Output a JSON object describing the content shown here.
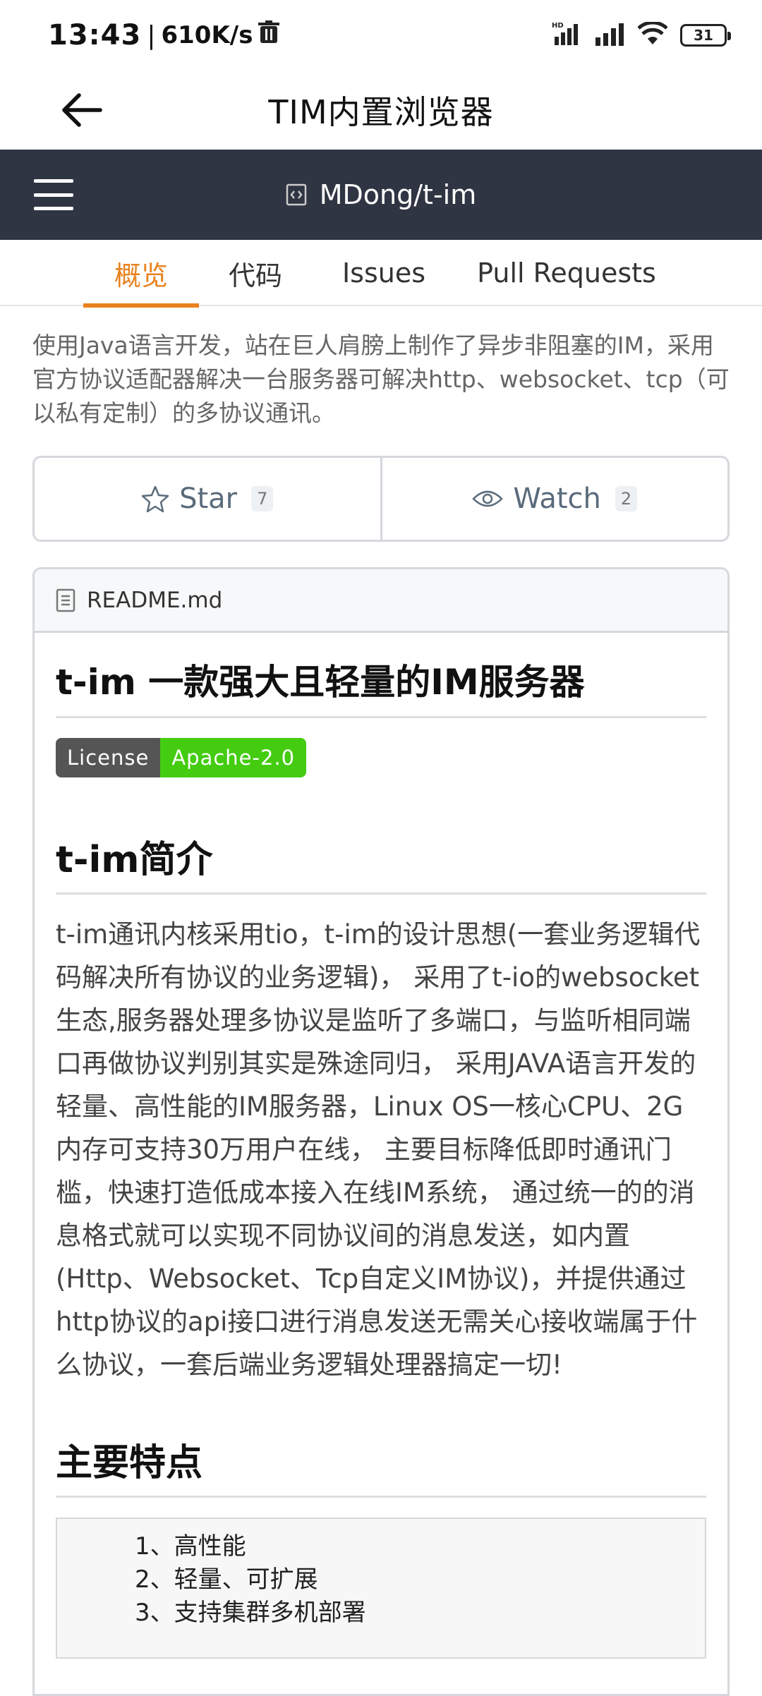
{
  "status_bar": {
    "time": "13:43",
    "speed": "610K/s",
    "battery": "31"
  },
  "browser": {
    "title": "TIM内置浏览器"
  },
  "repo_header": {
    "title": "MDong/t-im"
  },
  "tabs": [
    {
      "label": "概览",
      "active": true
    },
    {
      "label": "代码",
      "active": false
    },
    {
      "label": "Issues",
      "active": false
    },
    {
      "label": "Pull Requests",
      "active": false
    }
  ],
  "description": "使用Java语言开发，站在巨人肩膀上制作了异步非阻塞的IM，采用官方协议适配器解决一台服务器可解决http、websocket、tcp（可以私有定制）的多协议通讯。",
  "actions": {
    "star_label": "Star",
    "star_count": "7",
    "watch_label": "Watch",
    "watch_count": "2"
  },
  "readme": {
    "filename": "README.md",
    "heading": "t-im 一款强大且轻量的IM服务器",
    "license_badge": {
      "left": "License",
      "right": "Apache-2.0"
    },
    "intro_heading": "t-im简介",
    "intro_text": "t-im通讯内核采用tio，t-im的设计思想(一套业务逻辑代码解决所有协议的业务逻辑)， 采用了t-io的websocket生态,服务器处理多协议是监听了多端口，与监听相同端口再做协议判别其实是殊途同归， 采用JAVA语言开发的轻量、高性能的IM服务器，Linux OS一核心CPU、2G内存可支持30万用户在线， 主要目标降低即时通讯门槛，快速打造低成本接入在线IM系统， 通过统一的的消息格式就可以实现不同协议间的消息发送，如内置(Http、Websocket、Tcp自定义IM协议)，并提供通过http协议的api接口进行消息发送无需关心接收端属于什么协议，一套后端业务逻辑处理器搞定一切!",
    "features_heading": "主要特点",
    "features": [
      "1、高性能",
      "2、轻量、可扩展",
      "3、支持集群多机部署"
    ]
  }
}
